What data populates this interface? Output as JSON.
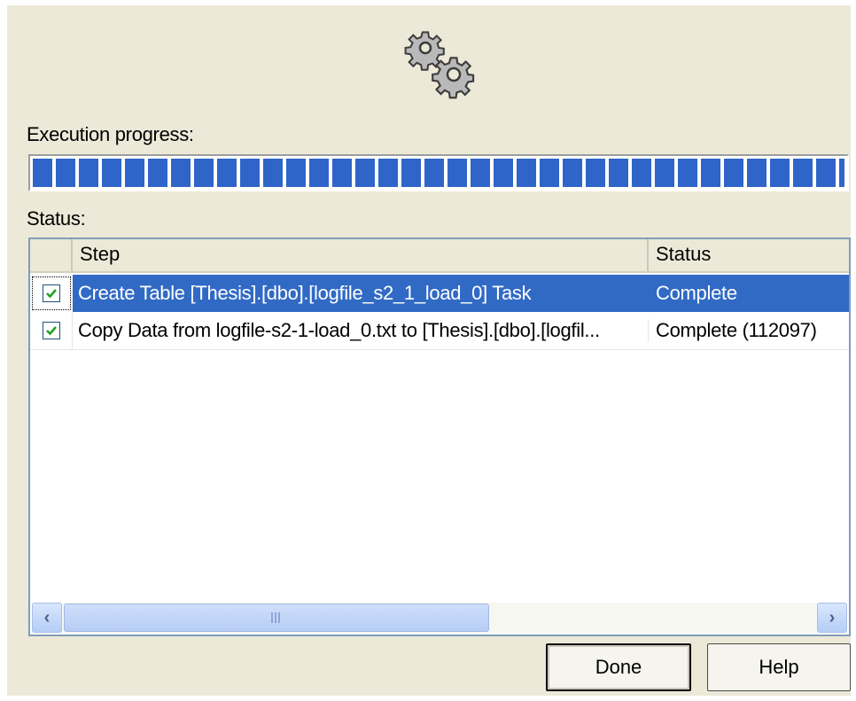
{
  "labels": {
    "execution_progress": "Execution progress:",
    "status": "Status:"
  },
  "progress": {
    "percent": 100,
    "color": "#316ac5"
  },
  "icons": {
    "header": "gears-icon"
  },
  "table": {
    "columns": [
      "",
      "Step",
      "Status"
    ],
    "rows": [
      {
        "checked": true,
        "step": "Create Table [Thesis].[dbo].[logfile_s2_1_load_0] Task",
        "status": "Complete",
        "selected": true
      },
      {
        "checked": true,
        "step": "Copy Data from logfile-s2-1-load_0.txt to [Thesis].[dbo].[logfil...",
        "status": "Complete (112097)",
        "selected": false
      }
    ]
  },
  "buttons": {
    "done": "Done",
    "help": "Help"
  },
  "colors": {
    "selection": "#316ac5",
    "dialog_bg": "#ece9d8",
    "check": "#21a121"
  }
}
